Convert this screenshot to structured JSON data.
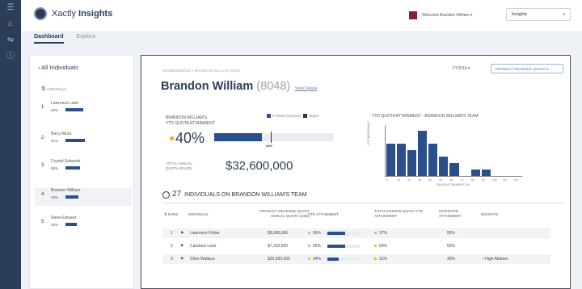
{
  "brand": {
    "name_light": "Xactly",
    "name_bold": "Insights"
  },
  "nav_tabs": [
    {
      "label": "Dashboard"
    },
    {
      "label": "Explore"
    }
  ],
  "user": {
    "name": "Welcome Brandon William"
  },
  "product_select": {
    "value": "Insights"
  },
  "left_panel": {
    "back_label": "All Individuals",
    "col_header": "INDIVIDUAL",
    "items": [
      {
        "rank": "1",
        "name": "Lawrence Lane",
        "pct": "50%",
        "bar": 0.55
      },
      {
        "rank": "2",
        "name": "Barry Ricks",
        "pct": "51%",
        "bar": 0.6
      },
      {
        "rank": "3",
        "name": "Crystal Edwards",
        "pct": "56%",
        "bar": 0.45
      },
      {
        "rank": "4",
        "name": "Brandon William",
        "pct": "40%",
        "bar": 0.4
      },
      {
        "rank": "5",
        "name": "Steve Edward",
        "pct": "30%",
        "bar": 0.35
      }
    ]
  },
  "main": {
    "breadcrumb": "All INDIVIDUALS",
    "breadcrumb_sep": ">",
    "breadcrumb_current": "BRANDON WILLIAM (8048)",
    "fy_label": "FY2019",
    "fy_button": "PRODUCT REVENUE QUOTA",
    "title_name": "Brandon William",
    "title_id": "(8048)",
    "view_details": "View Details",
    "attainment_title_1": "BRANDON WILLIAM'S",
    "attainment_title_2": "YTD QUOTA ATTAINMENT",
    "legend_current": "FY2019 (Current)",
    "legend_target": "Target",
    "attainment_pct": "40%",
    "attainment_value": 0.4,
    "attainment_bar_label": "44%",
    "total_quota_label_1": "TOTAL ANNUAL",
    "total_quota_label_2": "QUOTA (RUSD)",
    "total_quota_value": "$32,600,000",
    "team_count": "27",
    "team_label": "INDIVIDUALS ON BRANDON WILLIAM'S TEAM"
  },
  "chart_data": {
    "type": "bar",
    "title": "YTD QUOTA ATTAINMENT - BRANDON WILLIAM'S TEAM",
    "ylabel": "# OF INDIVIDUALS",
    "xlabel": "QUOTA ATTAINMENT (%)",
    "categories": [
      "0",
      "10",
      "20",
      "30",
      "40",
      "50",
      "60",
      "70",
      "80",
      "90",
      "100",
      "110",
      "120"
    ],
    "values": [
      5,
      5,
      4,
      7,
      5,
      3,
      2,
      0,
      1,
      1,
      0,
      0,
      0
    ],
    "ylim": [
      0,
      8
    ]
  },
  "table": {
    "headers": {
      "rank": "RANK",
      "individual": "INDIVIDUAL",
      "quota": "PRODUCT REVENUE QUOTA ANNUAL QUOTA (USD)",
      "ytd": "YTD ATTAINMENT",
      "margin": "TOTAL MARGIN QUOTA YTD ATTAINMENT",
      "incentive": "INCENTIVE ATTAINMENT",
      "insights": "INSIGHTS"
    },
    "rows": [
      {
        "rank": "1",
        "name": "Lawrence Fisher",
        "quota": "$9,000,000",
        "ytd": "56%",
        "ytd_v": 0.56,
        "margin": "37%",
        "incentive": "55%",
        "insight": ""
      },
      {
        "rank": "2",
        "name": "Candace Lane",
        "quota": "$7,310,000",
        "ytd": "56%",
        "ytd_v": 0.56,
        "margin": "50%",
        "incentive": "55%",
        "insight": ""
      },
      {
        "rank": "3",
        "name": "Chris Wallace",
        "quota": "$20,500,000",
        "ytd": "34%",
        "ytd_v": 0.34,
        "margin": "31%",
        "incentive": "30%",
        "insight": "High Attainer"
      }
    ]
  }
}
